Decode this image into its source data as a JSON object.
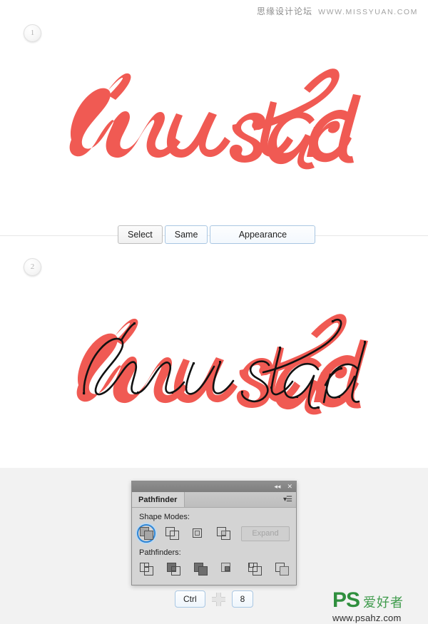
{
  "watermarks": {
    "top_cn": "思缘设计论坛",
    "top_url": "WWW.MISSYUAN.COM",
    "bottom_brand": "PS",
    "bottom_cn": "爱好者",
    "bottom_url": "www.psahz.com"
  },
  "steps": [
    {
      "number": "1",
      "artwork_label": "mustard"
    },
    {
      "number": "2",
      "artwork_label": "mustard"
    }
  ],
  "menu_path": {
    "buttons": [
      {
        "label": "Select",
        "style": "grey"
      },
      {
        "label": "Same",
        "style": "blue"
      },
      {
        "label": "Appearance",
        "style": "blue"
      }
    ]
  },
  "pathfinder_panel": {
    "tab_label": "Pathfinder",
    "titlebar_icons": [
      "collapse-icon",
      "close-icon"
    ],
    "menu_icon": "panel-menu-icon",
    "shape_modes_label": "Shape Modes:",
    "shape_modes": [
      {
        "name": "unite-icon",
        "selected": true
      },
      {
        "name": "minus-front-icon",
        "selected": false
      },
      {
        "name": "intersect-icon",
        "selected": false
      },
      {
        "name": "exclude-icon",
        "selected": false
      }
    ],
    "expand_label": "Expand",
    "expand_enabled": false,
    "pathfinders_label": "Pathfinders:",
    "pathfinders": [
      {
        "name": "divide-icon"
      },
      {
        "name": "trim-icon"
      },
      {
        "name": "merge-icon"
      },
      {
        "name": "crop-icon"
      },
      {
        "name": "outline-icon"
      },
      {
        "name": "minus-back-icon"
      }
    ]
  },
  "shortcut": {
    "modifier_key": "Ctrl",
    "plus_icon": "plus-icon",
    "key": "8"
  },
  "colors": {
    "artwork_red": "#f05a53",
    "artwork_stroke": "#000000",
    "panel_bg": "#d4d4d4",
    "selection_blue": "#2f86d6",
    "watermark_green": "#2f8f3e"
  }
}
